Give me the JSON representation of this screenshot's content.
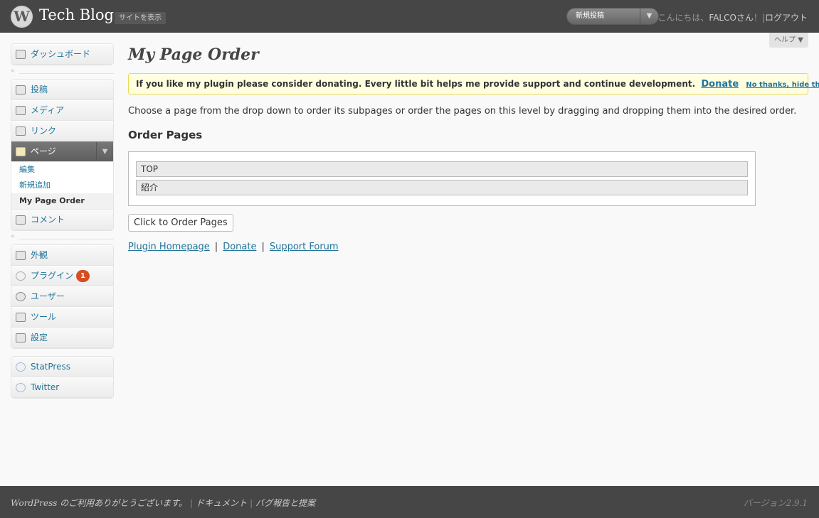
{
  "header": {
    "logo_char": "W",
    "site_title": "Tech Blog",
    "view_site_label": "サイトを表示",
    "favorite_action_label": "新規投稿",
    "greeting": "こんにちは、",
    "username": "FALCOさん",
    "greeting_suffix": "！|",
    "logout_label": "ログアウト"
  },
  "help_tab": {
    "label": "ヘルプ ▼"
  },
  "sidebar": {
    "dashboard": "ダッシュボード",
    "posts": "投稿",
    "media": "メディア",
    "links": "リンク",
    "pages": "ページ",
    "pages_submenu": [
      "編集",
      "新規追加",
      "My Page Order"
    ],
    "comments": "コメント",
    "appearance": "外観",
    "plugins": "プラグイン",
    "plugins_badge": "1",
    "users": "ユーザー",
    "tools": "ツール",
    "settings": "設定",
    "statpress": "StatPress",
    "twitter": "Twitter"
  },
  "main": {
    "title": "My Page Order",
    "notice_text": "If you like my plugin please consider donating. Every little bit helps me provide support and continue development.",
    "notice_donate": "Donate",
    "notice_hide": "No thanks, hide this",
    "instructions": "Choose a page from the drop down to order its subpages or order the pages on this level by dragging and dropping them into the desired order.",
    "order_heading": "Order Pages",
    "order_items": [
      "TOP",
      "紹介"
    ],
    "order_button": "Click to Order Pages",
    "links": [
      "Plugin Homepage",
      "Donate",
      "Support Forum"
    ],
    "link_separator": "|"
  },
  "footer": {
    "thanks": "WordPress のご利用ありがとうございます。",
    "separator": "|",
    "documentation": "ドキュメント",
    "separator2": "|",
    "bug_report": "バグ報告と提案",
    "version": "バージョン2.9.1"
  }
}
